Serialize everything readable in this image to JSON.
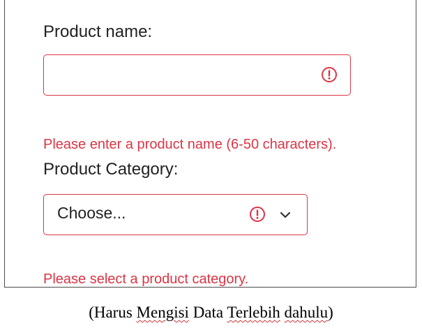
{
  "form": {
    "product_name": {
      "label": "Product name:",
      "value": "",
      "error_icon": "exclamation-circle-icon",
      "feedback": "Please enter a product name (6-50 characters)."
    },
    "product_category": {
      "label": "Product Category:",
      "selected": "Choose...",
      "error_icon": "exclamation-circle-icon",
      "dropdown_icon": "chevron-down-icon",
      "feedback": "Please select a product category."
    }
  },
  "caption": {
    "open_paren": "(",
    "w1": "Harus",
    "w2": "Mengisi",
    "w3": "Data",
    "w4": "Terlebih",
    "w5": "dahulu",
    "close_paren": ")"
  },
  "colors": {
    "invalid": "#dc3545",
    "text": "#222222",
    "frame_border": "#4a4a4a",
    "spellcheck_underline": "#d13438"
  }
}
